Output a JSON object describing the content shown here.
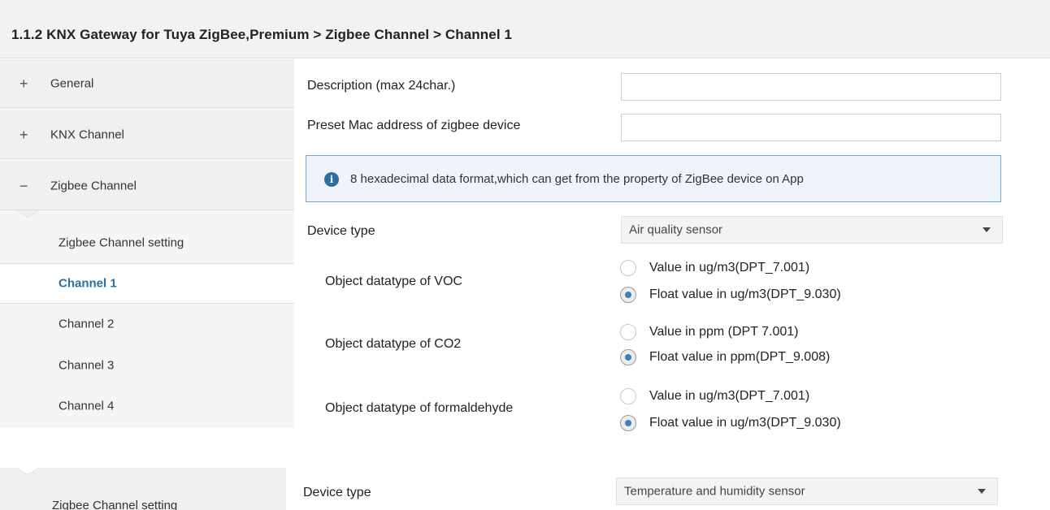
{
  "header": {
    "title": "1.1.2 KNX Gateway for Tuya ZigBee,Premium > Zigbee Channel > Channel 1"
  },
  "sidebar": {
    "items": [
      {
        "sign": "+",
        "label": "General"
      },
      {
        "sign": "+",
        "label": "KNX Channel"
      },
      {
        "sign": "−",
        "label": "Zigbee Channel"
      }
    ],
    "sub_items": [
      {
        "label": "Zigbee Channel setting"
      },
      {
        "label": "Channel 1"
      },
      {
        "label": "Channel 2"
      },
      {
        "label": "Channel 3"
      },
      {
        "label": "Channel 4"
      }
    ]
  },
  "main": {
    "description_label": "Description (max 24char.)",
    "description_value": "",
    "mac_label": "Preset Mac address of zigbee device",
    "mac_value": "",
    "info_text": "8 hexadecimal data format,which can get from the property of ZigBee device on App",
    "device_type_label": "Device type",
    "device_type_value": "Air quality sensor",
    "params": [
      {
        "label": "Object datatype of VOC",
        "options": [
          "Value in ug/m3(DPT_7.001)",
          "Float value in ug/m3(DPT_9.030)"
        ],
        "selected": 1
      },
      {
        "label": "Object datatype of CO2",
        "options": [
          "Value in ppm (DPT 7.001)",
          "Float value in ppm(DPT_9.008)"
        ],
        "selected": 1
      },
      {
        "label": "Object datatype of formaldehyde",
        "options": [
          "Value in ug/m3(DPT_7.001)",
          "Float value in ug/m3(DPT_9.030)"
        ],
        "selected": 1
      }
    ]
  },
  "bottom": {
    "side_label": "Zigbee Channel setting",
    "device_type_label": "Device type",
    "device_type_value": "Temperature and humidity sensor"
  },
  "colors": {
    "accent": "#2e6da4",
    "info_border": "#7aa7cf",
    "info_bg": "#eef4f9"
  }
}
